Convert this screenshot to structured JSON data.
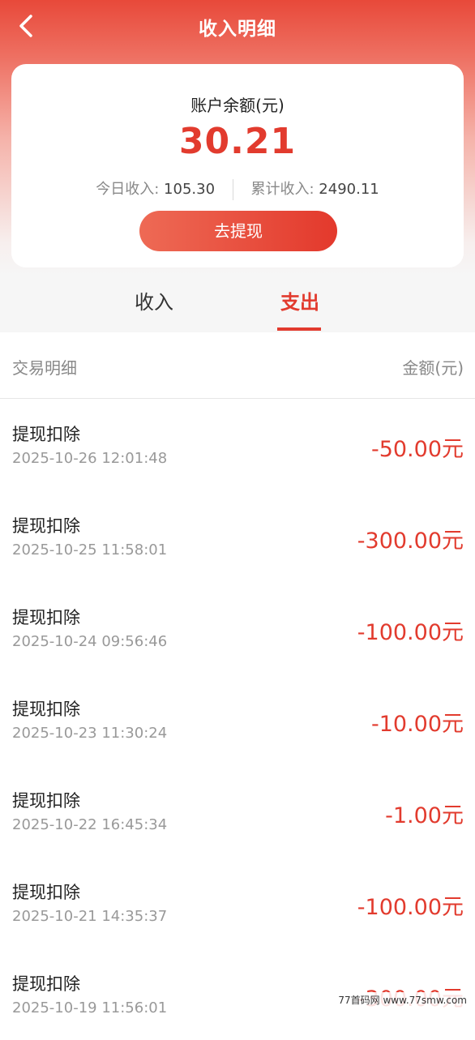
{
  "nav": {
    "title": "收入明细"
  },
  "card": {
    "balance_label": "账户余额(元)",
    "balance_value": "30.21",
    "today_label": "今日收入: ",
    "today_value": "105.30",
    "total_label": "累计收入: ",
    "total_value": "2490.11",
    "withdraw_label": "去提现"
  },
  "tabs": [
    {
      "label": "收入",
      "active": false
    },
    {
      "label": "支出",
      "active": true
    }
  ],
  "list_header": {
    "left": "交易明细",
    "right": "金额(元)"
  },
  "records": [
    {
      "title": "提现扣除",
      "time": "2025-10-26 12:01:48",
      "amount": "-50.00元"
    },
    {
      "title": "提现扣除",
      "time": "2025-10-25 11:58:01",
      "amount": "-300.00元"
    },
    {
      "title": "提现扣除",
      "time": "2025-10-24 09:56:46",
      "amount": "-100.00元"
    },
    {
      "title": "提现扣除",
      "time": "2025-10-23 11:30:24",
      "amount": "-10.00元"
    },
    {
      "title": "提现扣除",
      "time": "2025-10-22 16:45:34",
      "amount": "-1.00元"
    },
    {
      "title": "提现扣除",
      "time": "2025-10-21 14:35:37",
      "amount": "-100.00元"
    },
    {
      "title": "提现扣除",
      "time": "2025-10-19 11:56:01",
      "amount": "-300.00元"
    }
  ],
  "watermark": "77首码网 www.77smw.com",
  "colors": {
    "accent": "#e23b2e",
    "header_top": "#e8493a"
  }
}
